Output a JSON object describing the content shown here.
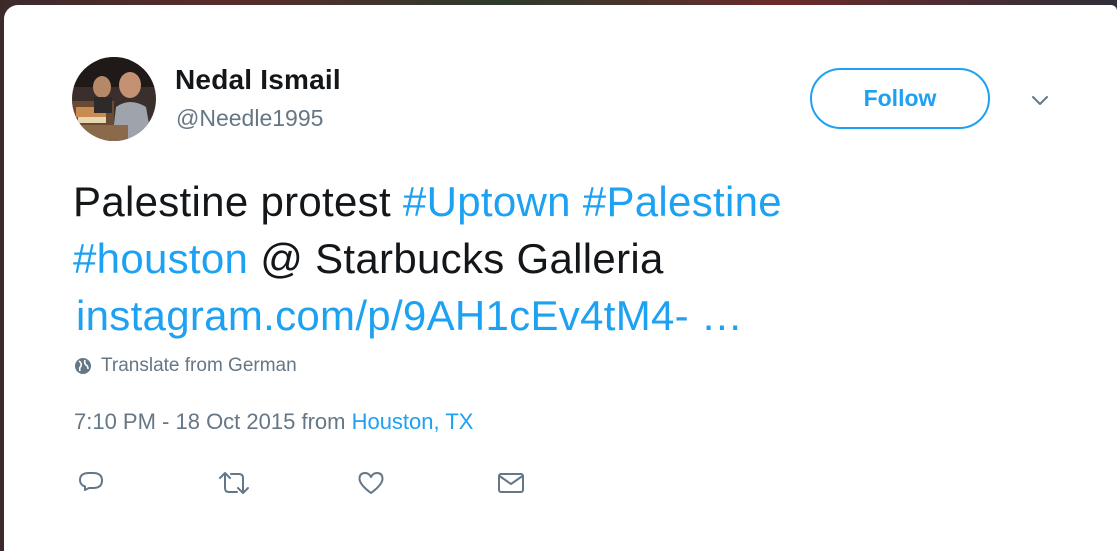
{
  "author": {
    "name": "Nedal Ismail",
    "handle": "@Needle1995",
    "avatar_icon": "profile-photo"
  },
  "follow_label": "Follow",
  "tweet": {
    "text_plain": "Palestine protest ",
    "hashtags": [
      "#Uptown",
      "#Palestine",
      "#houston"
    ],
    "location_text": " @ Starbucks Galleria",
    "link": "instagram.com/p/9AH1cEv4tM4- …"
  },
  "translate_label": "Translate from German",
  "timestamp": {
    "time": "7:10 PM - 18 Oct 2015 from ",
    "place": "Houston, TX"
  },
  "actions": [
    {
      "icon": "reply-icon"
    },
    {
      "icon": "retweet-icon"
    },
    {
      "icon": "like-icon"
    },
    {
      "icon": "direct-message-icon"
    }
  ],
  "colors": {
    "accent": "#1da1f2",
    "text": "#14171a",
    "secondary": "#657786"
  }
}
